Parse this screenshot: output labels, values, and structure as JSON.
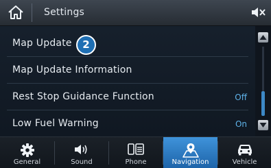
{
  "header": {
    "title": "Settings",
    "home_icon": "home-icon",
    "mute_icon": "speaker-mute-icon"
  },
  "list": {
    "items": [
      {
        "label": "Map Update",
        "value": "",
        "callout": "2"
      },
      {
        "label": "Map Update Information",
        "value": ""
      },
      {
        "label": "Rest Stop Guidance Function",
        "value": "Off"
      },
      {
        "label": "Low Fuel Warning",
        "value": "On"
      }
    ],
    "scroll_position": 0.75
  },
  "tabs": [
    {
      "label": "General",
      "icon": "gear-icon",
      "active": false
    },
    {
      "label": "Sound",
      "icon": "speaker-icon",
      "active": false
    },
    {
      "label": "Phone",
      "icon": "phone-icon",
      "active": false
    },
    {
      "label": "Navigation",
      "icon": "map-pin-icon",
      "active": true
    },
    {
      "label": "Vehicle",
      "icon": "car-icon",
      "active": false
    }
  ],
  "colors": {
    "accent": "#2f80c7",
    "value_text": "#5fb3ea",
    "callout_fill": "#1f6fb3"
  }
}
